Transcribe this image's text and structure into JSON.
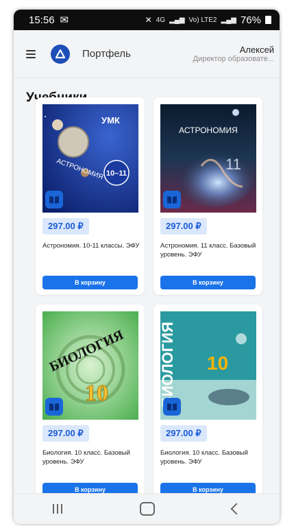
{
  "status_bar": {
    "time": "15:56",
    "network": "4G",
    "signal": "Vo) LTE2",
    "battery": "76%"
  },
  "header": {
    "app_title": "Портфель",
    "user_name": "Алексей",
    "user_role": "Директор образовате..."
  },
  "section_title": "Учебники",
  "accent_color": "#1a73e8",
  "books": [
    {
      "price": "297.00 ₽",
      "title": "Астрономия. 10-11 классы. ЭФУ",
      "button": "В корзину",
      "cover_main": "АСТРОНОМИЯ",
      "cover_grade": "10–11",
      "cover_series": "УМК"
    },
    {
      "price": "297.00 ₽",
      "title": "Астрономия. 11 класс. Базовый уровень. ЭФУ",
      "button": "В корзину",
      "cover_main": "АСТРОНОМИЯ",
      "cover_grade": "11"
    },
    {
      "price": "297.00 ₽",
      "title": "Биология. 10 класс. Базовый уровень. ЭФУ",
      "button": "В корзину",
      "cover_main": "БИОЛОГИЯ",
      "cover_grade": "10"
    },
    {
      "price": "297.00 ₽",
      "title": "Биология. 10 класс. Базовый уровень. ЭФУ",
      "button": "В корзину",
      "cover_main": "БИОЛОГИЯ",
      "cover_grade": "10"
    }
  ]
}
